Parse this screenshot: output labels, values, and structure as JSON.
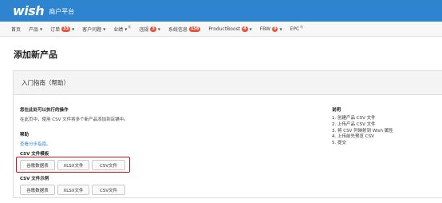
{
  "header": {
    "logo": "wish",
    "subtitle": "商户平台"
  },
  "nav": [
    {
      "label": "首页",
      "badge": "",
      "caret": false,
      "new": false
    },
    {
      "label": "产品",
      "badge": "",
      "caret": true,
      "new": false
    },
    {
      "label": "订单",
      "badge": "33",
      "caret": true,
      "new": false
    },
    {
      "label": "客户问题",
      "badge": "",
      "caret": true,
      "new": false
    },
    {
      "label": "业绩",
      "badge": "",
      "caret": true,
      "new": true
    },
    {
      "label": "违规",
      "badge": "3",
      "caret": true,
      "new": false
    },
    {
      "label": "系统信息",
      "badge": "158",
      "caret": false,
      "new": false
    },
    {
      "label": "ProductBoost",
      "badge": "4",
      "caret": true,
      "new": false
    },
    {
      "label": "FBW",
      "badge": "0",
      "caret": true,
      "new": false
    },
    {
      "label": "EPC",
      "badge": "",
      "caret": false,
      "new": true
    }
  ],
  "nav_new_tag": "新",
  "nav_caret": "▼",
  "page_title": "添加新产品",
  "panel": {
    "title": "入门指南（帮助）",
    "actions_heading": "您在此处可以执行的操作",
    "actions_text": "在此页中，使用 CSV 文件将多个新产品添加到店铺中。",
    "help_heading": "帮助",
    "help_link": "查看分步指南。",
    "template_heading": "CSV 文件模板",
    "template_buttons": [
      "谷歌数据表",
      "XLSX文件",
      "CSV文件"
    ],
    "example_heading": "CSV 文件示例",
    "example_buttons": [
      "谷歌数据表",
      "XLSX文件",
      "CSV文件"
    ],
    "explain_heading": "说明",
    "steps": [
      "1. 创建产品 CSV 文件",
      "2. 上传产品 CSV 文件",
      "3. 将 CSV 列映射到 Wish 属性",
      "4. 上传前先预览 CSV",
      "5. 提交"
    ]
  },
  "colors": {
    "topbar": "#2e84cf",
    "badge": "#e8563a",
    "highlight": "#c9151e",
    "link": "#2e84cf"
  }
}
